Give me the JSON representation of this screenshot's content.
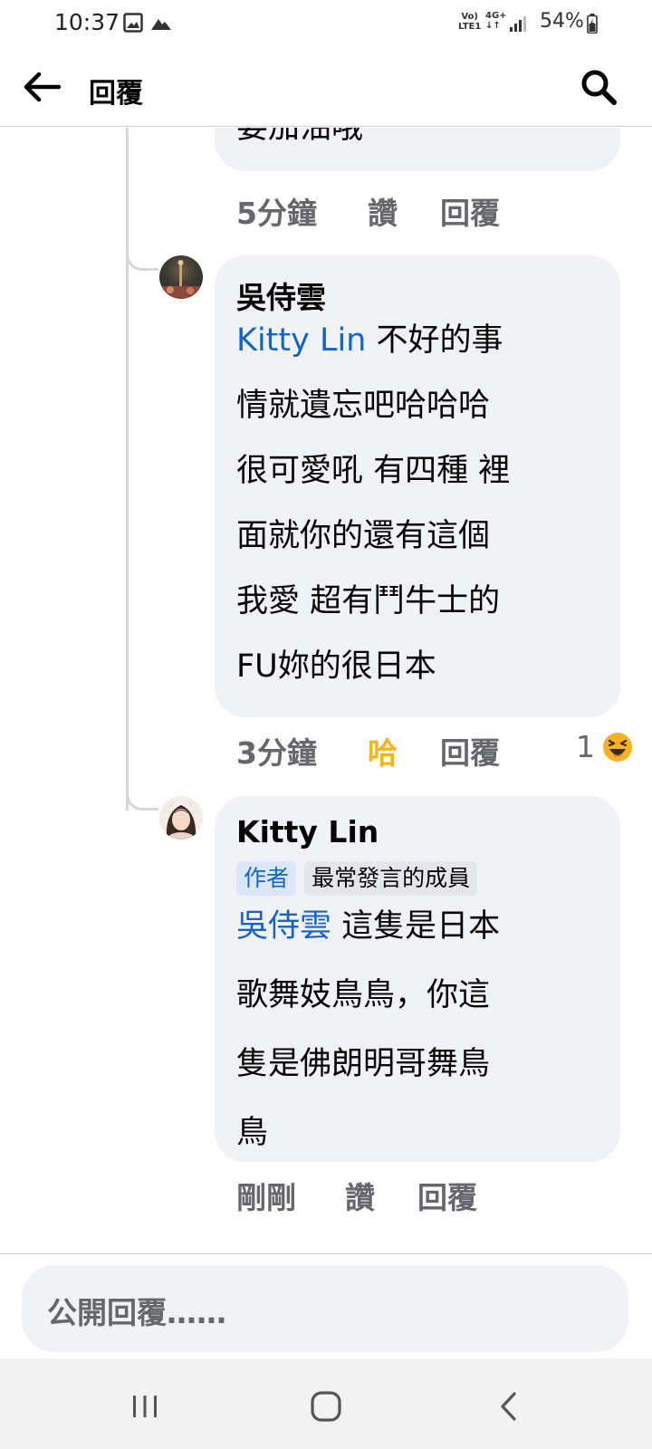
{
  "status_bar": {
    "time": "10:37",
    "volte_line1": "Vo)",
    "volte_line2": "LTE1",
    "network": "4G+",
    "battery": "54%"
  },
  "header": {
    "title": "回覆",
    "back_icon": "arrow-left-icon",
    "search_icon": "search-icon"
  },
  "comments": [
    {
      "text_partial": "要加油哦",
      "time": "5分鐘",
      "like_label": "讚",
      "reply_label": "回覆"
    },
    {
      "author": "吳侍雲",
      "mention": "Kitty Lin",
      "lines": [
        " 不好的事",
        "情就遺忘吧哈哈哈",
        "很可愛吼 有四種 裡",
        "面就你的還有這個",
        "我愛  超有鬥牛士的",
        "FU妳的很日本"
      ],
      "time": "3分鐘",
      "reaction_label": "哈",
      "reply_label": "回覆",
      "reaction_count": "1",
      "reaction_icon": "haha-emoji-icon"
    },
    {
      "author": "Kitty Lin",
      "badges": [
        "作者",
        "最常發言的成員"
      ],
      "mention": "吳侍雲",
      "lines": [
        " 這隻是日本",
        "歌舞妓鳥鳥，你這",
        "隻是佛朗明哥舞鳥",
        "鳥"
      ],
      "time": "剛剛",
      "like_label": "讚",
      "reply_label": "回覆"
    }
  ],
  "composer": {
    "placeholder": "公開回覆……"
  },
  "colors": {
    "bubble_bg": "#f0f2f5",
    "mention": "#1464c8",
    "haha_active": "#f7b125",
    "meta_gray": "#65676b"
  }
}
